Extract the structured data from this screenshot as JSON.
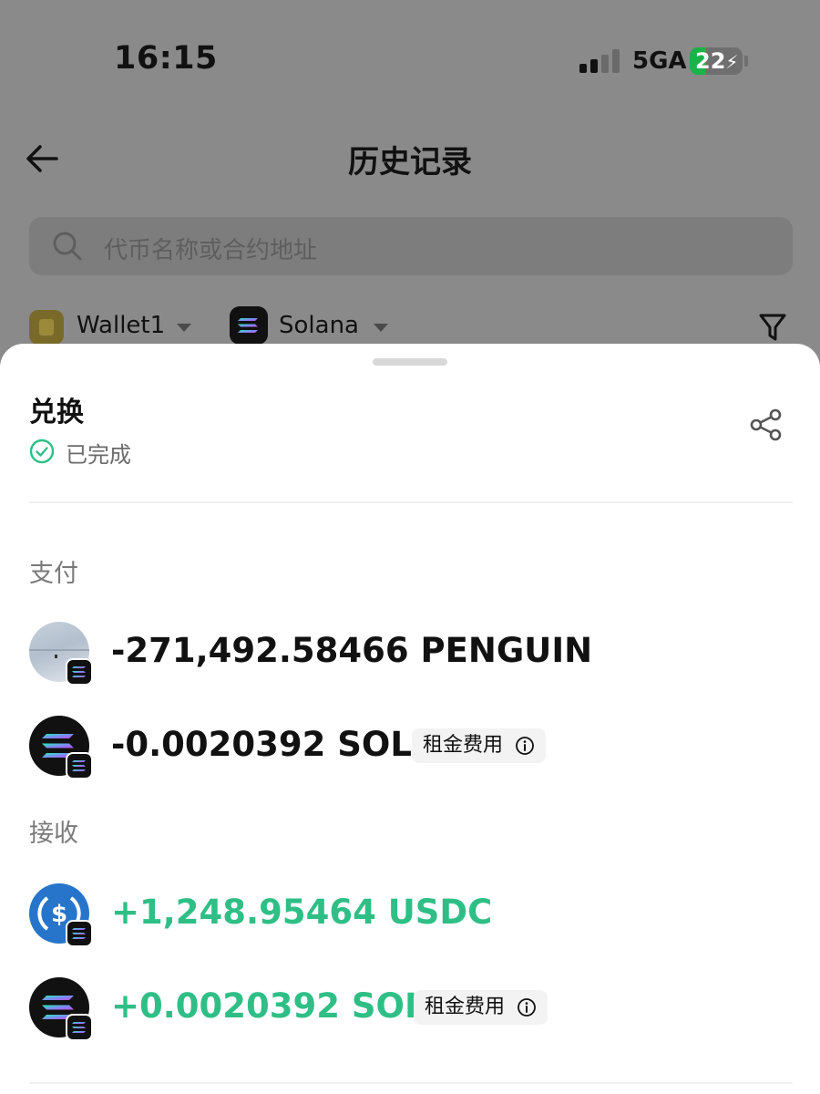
{
  "status_bar": {
    "time": "16:15",
    "network": "5GA",
    "battery": "22"
  },
  "nav": {
    "title": "历史记录"
  },
  "search": {
    "placeholder": "代币名称或合约地址"
  },
  "filters": {
    "wallet": "Wallet1",
    "chain": "Solana"
  },
  "sheet": {
    "title": "兑换",
    "status": "已完成",
    "pay_label": "支付",
    "receive_label": "接收",
    "pay": [
      {
        "amount": "-271,492.58466 PENGUIN",
        "token": "penguin-token-icon"
      },
      {
        "amount": "-0.0020392 SOL",
        "token": "solana-token-icon",
        "tag": "租金费用"
      }
    ],
    "receive": [
      {
        "amount": "+1,248.95464 USDC",
        "token": "usdc-token-icon"
      },
      {
        "amount": "+0.0020392 SOL",
        "token": "solana-token-icon",
        "tag": "租金费用"
      }
    ]
  },
  "colors": {
    "positive": "#2fbf86",
    "negative": "#111111",
    "overlay": "#8a8a8a"
  }
}
